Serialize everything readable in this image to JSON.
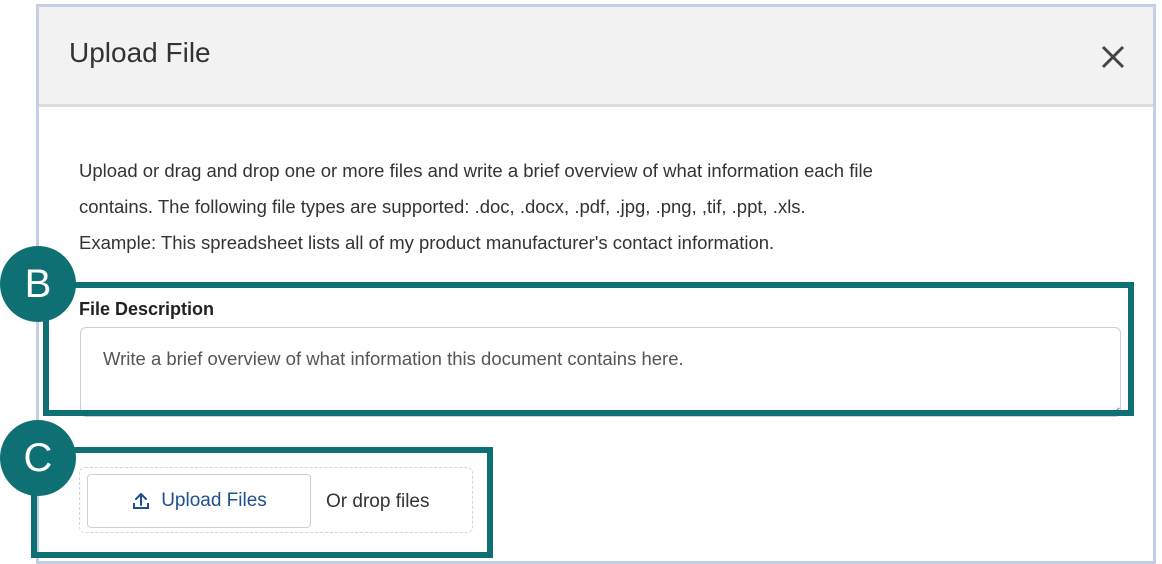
{
  "dialog": {
    "title": "Upload File",
    "close_icon": "close-icon"
  },
  "intro": {
    "line1": "Upload or drag and drop one or more files and write a brief overview of what information each file",
    "line2": "contains. The following file types are supported: .doc, .docx, .pdf, .jpg, .png, ,tif, .ppt, .xls.",
    "line3": "Example: This spreadsheet lists all of my product manufacturer's contact information."
  },
  "description": {
    "label": "File Description",
    "placeholder": "Write a brief overview of what information this document contains here.",
    "value": ""
  },
  "upload": {
    "button_label": "Upload Files",
    "button_icon": "upload-icon",
    "drop_text": "Or drop files"
  },
  "callouts": {
    "b_label": "B",
    "c_label": "C"
  },
  "colors": {
    "callout": "#0f7073",
    "header_bg": "#f2f2f2",
    "modal_border": "#c4cfe3",
    "link_blue": "#1f4f8f"
  }
}
